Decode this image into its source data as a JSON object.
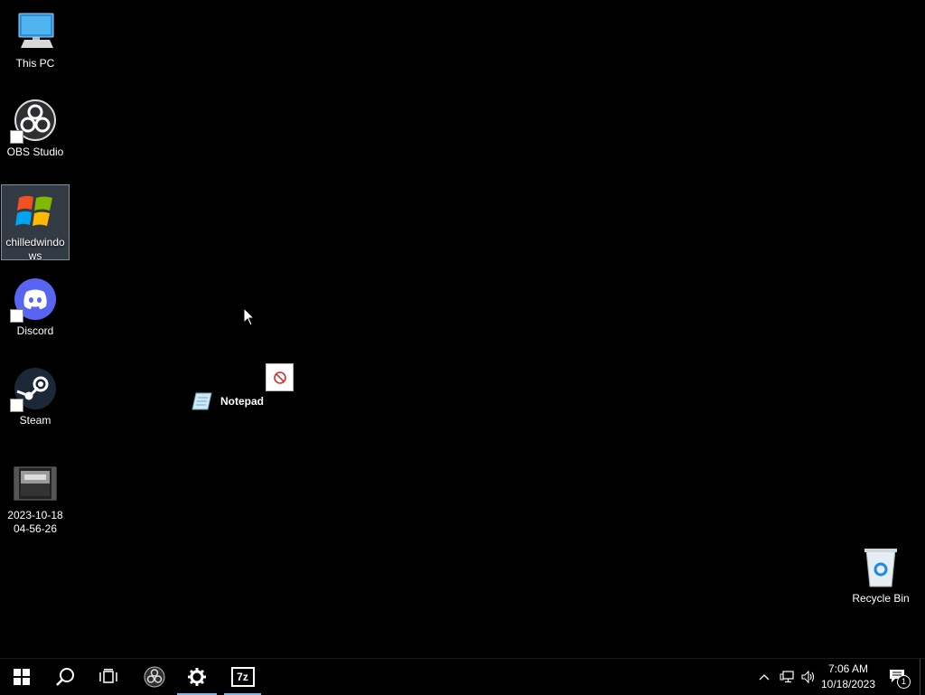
{
  "desktop": {
    "icons": [
      {
        "label": "This PC",
        "icon": "computer-icon"
      },
      {
        "label": "OBS Studio",
        "icon": "obs-icon"
      },
      {
        "label": "chilledwindows",
        "icon": "windows-xp-flag-icon"
      },
      {
        "label": "Discord",
        "icon": "discord-icon"
      },
      {
        "label": "Steam",
        "icon": "steam-icon"
      },
      {
        "label": "2023-10-18\n04-56-26",
        "icon": "video-file-icon"
      },
      {
        "label": "Recycle Bin",
        "icon": "recycle-bin-icon"
      }
    ],
    "drag": {
      "label": "Notepad",
      "icon": "notepad-icon",
      "indicator": "no-drop-icon"
    }
  },
  "taskbar": {
    "buttons": [
      {
        "name": "start",
        "icon": "windows-logo-icon"
      },
      {
        "name": "search",
        "icon": "search-icon"
      },
      {
        "name": "task-view",
        "icon": "task-view-icon"
      },
      {
        "name": "obs",
        "icon": "obs-icon"
      },
      {
        "name": "settings",
        "icon": "gear-icon"
      },
      {
        "name": "7zip",
        "icon": "7z-icon",
        "label": "7z"
      }
    ],
    "tray": {
      "time": "7:06 AM",
      "date": "10/18/2023",
      "notification_count": "1"
    }
  },
  "colors": {
    "accent": "#76b9ed",
    "discord": "#5865f2",
    "steam": "#1b2838"
  }
}
